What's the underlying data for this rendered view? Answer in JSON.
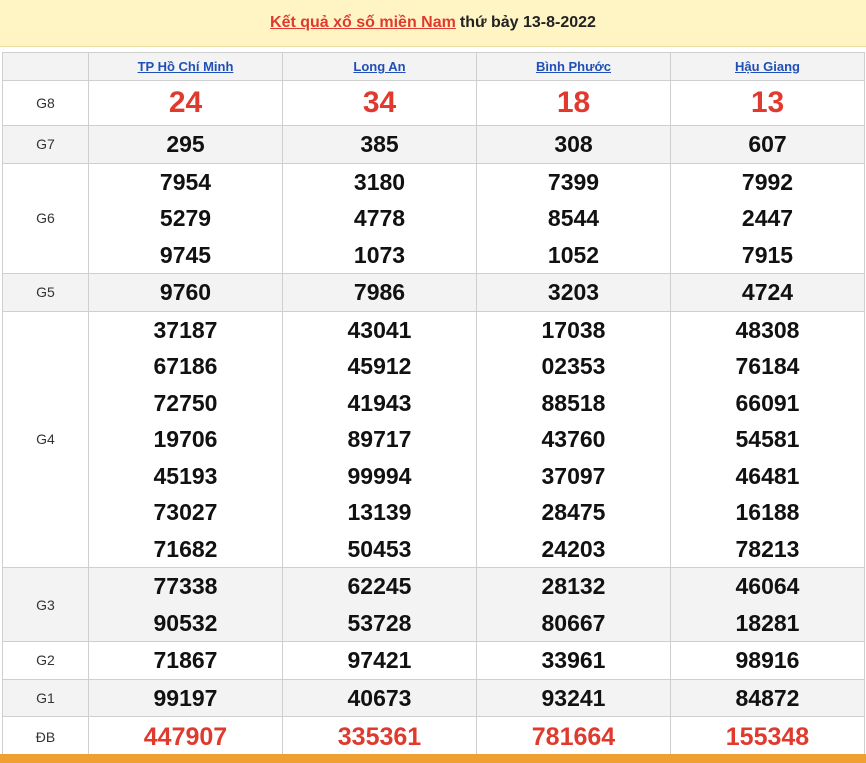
{
  "header": {
    "link_text": "Kết quả xổ số miền Nam",
    "date_text": "thứ bảy 13-8-2022"
  },
  "provinces": [
    "TP Hồ Chí Minh",
    "Long An",
    "Bình Phước",
    "Hậu Giang"
  ],
  "rows": [
    {
      "label": "G8",
      "cells": [
        [
          "24"
        ],
        [
          "34"
        ],
        [
          "18"
        ],
        [
          "13"
        ]
      ]
    },
    {
      "label": "G7",
      "cells": [
        [
          "295"
        ],
        [
          "385"
        ],
        [
          "308"
        ],
        [
          "607"
        ]
      ]
    },
    {
      "label": "G6",
      "cells": [
        [
          "7954",
          "5279",
          "9745"
        ],
        [
          "3180",
          "4778",
          "1073"
        ],
        [
          "7399",
          "8544",
          "1052"
        ],
        [
          "7992",
          "2447",
          "7915"
        ]
      ]
    },
    {
      "label": "G5",
      "cells": [
        [
          "9760"
        ],
        [
          "7986"
        ],
        [
          "3203"
        ],
        [
          "4724"
        ]
      ]
    },
    {
      "label": "G4",
      "cells": [
        [
          "37187",
          "67186",
          "72750",
          "19706",
          "45193",
          "73027",
          "71682"
        ],
        [
          "43041",
          "45912",
          "41943",
          "89717",
          "99994",
          "13139",
          "50453"
        ],
        [
          "17038",
          "02353",
          "88518",
          "43760",
          "37097",
          "28475",
          "24203"
        ],
        [
          "48308",
          "76184",
          "66091",
          "54581",
          "46481",
          "16188",
          "78213"
        ]
      ]
    },
    {
      "label": "G3",
      "cells": [
        [
          "77338",
          "90532"
        ],
        [
          "62245",
          "53728"
        ],
        [
          "28132",
          "80667"
        ],
        [
          "46064",
          "18281"
        ]
      ]
    },
    {
      "label": "G2",
      "cells": [
        [
          "71867"
        ],
        [
          "97421"
        ],
        [
          "33961"
        ],
        [
          "98916"
        ]
      ]
    },
    {
      "label": "G1",
      "cells": [
        [
          "99197"
        ],
        [
          "40673"
        ],
        [
          "93241"
        ],
        [
          "84872"
        ]
      ]
    },
    {
      "label": "ĐB",
      "cells": [
        [
          "447907"
        ],
        [
          "335361"
        ],
        [
          "781664"
        ],
        [
          "155348"
        ]
      ]
    }
  ],
  "colors": {
    "header_bg": "#fff4c4",
    "accent_red": "#e03a2f",
    "link_blue": "#1f4fb8",
    "alt_row_bg": "#f3f3f3",
    "footer_bar": "#f0a030"
  }
}
